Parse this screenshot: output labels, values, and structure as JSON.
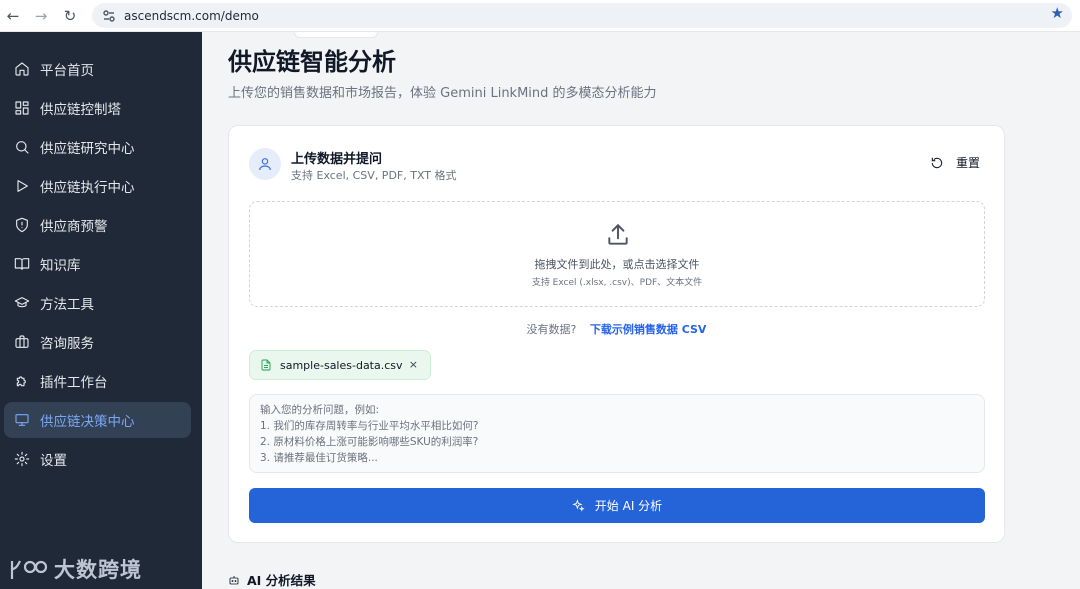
{
  "browser": {
    "url": "ascendscm.com/demo",
    "icons": [
      "back-arrow-icon",
      "forward-arrow-icon",
      "reload-icon",
      "site-settings-icon",
      "bookmark-star-icon"
    ]
  },
  "sidebar": {
    "items": [
      {
        "label": "平台首页",
        "icon": "home-icon",
        "active": false
      },
      {
        "label": "供应链控制塔",
        "icon": "grid-icon",
        "active": false
      },
      {
        "label": "供应链研究中心",
        "icon": "search-icon",
        "active": false
      },
      {
        "label": "供应链执行中心",
        "icon": "play-icon",
        "active": false
      },
      {
        "label": "供应商预警",
        "icon": "shield-alert-icon",
        "active": false
      },
      {
        "label": "知识库",
        "icon": "book-icon",
        "active": false
      },
      {
        "label": "方法工具",
        "icon": "graduation-cap-icon",
        "active": false
      },
      {
        "label": "咨询服务",
        "icon": "briefcase-icon",
        "active": false
      },
      {
        "label": "插件工作台",
        "icon": "puzzle-icon",
        "active": false
      },
      {
        "label": "供应链决策中心",
        "icon": "monitor-icon",
        "active": true
      },
      {
        "label": "设置",
        "icon": "gear-icon",
        "active": false
      }
    ],
    "watermark": "大数跨境"
  },
  "main": {
    "title": "供应链智能分析",
    "subtitle": "上传您的销售数据和市场报告，体验 Gemini LinkMind 的多模态分析能力",
    "upload_card": {
      "title": "上传数据并提问",
      "description": "支持 Excel, CSV, PDF, TXT 格式",
      "reset_label": "重置",
      "dropzone_main": "拖拽文件到此处，或点击选择文件",
      "dropzone_sub": "支持 Excel (.xlsx, .csv)、PDF、文本文件",
      "no_data_text": "没有数据?",
      "sample_link": "下载示例销售数据 CSV",
      "file_name": "sample-sales-data.csv",
      "file_remove": "×",
      "question_placeholder_lines": [
        "输入您的分析问题，例如:",
        "1. 我们的库存周转率与行业平均水平相比如何?",
        "2. 原材料价格上涨可能影响哪些SKU的利润率?",
        "3. 请推荐最佳订货策略..."
      ],
      "start_button": "开始 AI 分析"
    },
    "result_title": "AI 分析结果"
  },
  "colors": {
    "sidebar_bg": "#1f2937",
    "active_item_bg": "#334155",
    "active_item_text": "#7aa7f7",
    "primary_button": "#2563d9",
    "link": "#2563eb",
    "file_chip_bg": "#eaf7ee"
  }
}
